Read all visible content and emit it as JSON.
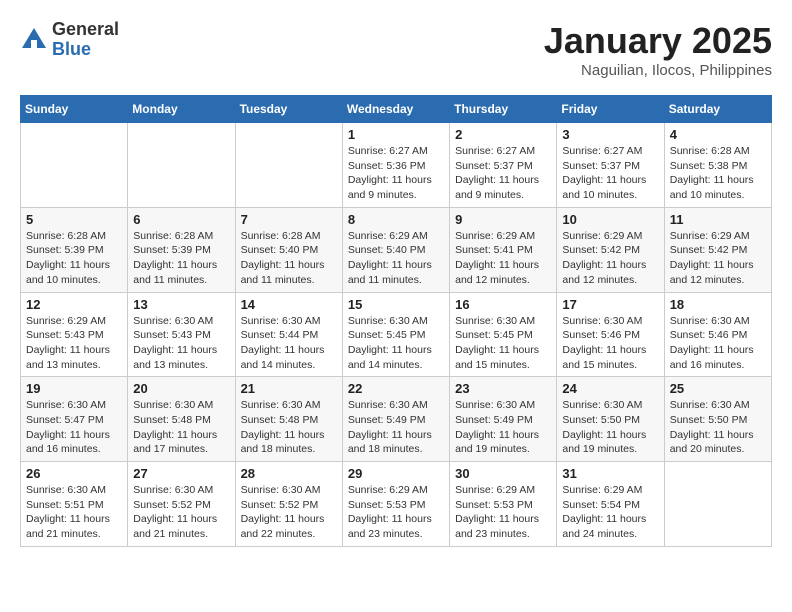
{
  "header": {
    "logo_general": "General",
    "logo_blue": "Blue",
    "month_title": "January 2025",
    "location": "Naguilian, Ilocos, Philippines"
  },
  "days_of_week": [
    "Sunday",
    "Monday",
    "Tuesday",
    "Wednesday",
    "Thursday",
    "Friday",
    "Saturday"
  ],
  "weeks": [
    [
      {
        "day": "",
        "info": ""
      },
      {
        "day": "",
        "info": ""
      },
      {
        "day": "",
        "info": ""
      },
      {
        "day": "1",
        "info": "Sunrise: 6:27 AM\nSunset: 5:36 PM\nDaylight: 11 hours and 9 minutes."
      },
      {
        "day": "2",
        "info": "Sunrise: 6:27 AM\nSunset: 5:37 PM\nDaylight: 11 hours and 9 minutes."
      },
      {
        "day": "3",
        "info": "Sunrise: 6:27 AM\nSunset: 5:37 PM\nDaylight: 11 hours and 10 minutes."
      },
      {
        "day": "4",
        "info": "Sunrise: 6:28 AM\nSunset: 5:38 PM\nDaylight: 11 hours and 10 minutes."
      }
    ],
    [
      {
        "day": "5",
        "info": "Sunrise: 6:28 AM\nSunset: 5:39 PM\nDaylight: 11 hours and 10 minutes."
      },
      {
        "day": "6",
        "info": "Sunrise: 6:28 AM\nSunset: 5:39 PM\nDaylight: 11 hours and 11 minutes."
      },
      {
        "day": "7",
        "info": "Sunrise: 6:28 AM\nSunset: 5:40 PM\nDaylight: 11 hours and 11 minutes."
      },
      {
        "day": "8",
        "info": "Sunrise: 6:29 AM\nSunset: 5:40 PM\nDaylight: 11 hours and 11 minutes."
      },
      {
        "day": "9",
        "info": "Sunrise: 6:29 AM\nSunset: 5:41 PM\nDaylight: 11 hours and 12 minutes."
      },
      {
        "day": "10",
        "info": "Sunrise: 6:29 AM\nSunset: 5:42 PM\nDaylight: 11 hours and 12 minutes."
      },
      {
        "day": "11",
        "info": "Sunrise: 6:29 AM\nSunset: 5:42 PM\nDaylight: 11 hours and 12 minutes."
      }
    ],
    [
      {
        "day": "12",
        "info": "Sunrise: 6:29 AM\nSunset: 5:43 PM\nDaylight: 11 hours and 13 minutes."
      },
      {
        "day": "13",
        "info": "Sunrise: 6:30 AM\nSunset: 5:43 PM\nDaylight: 11 hours and 13 minutes."
      },
      {
        "day": "14",
        "info": "Sunrise: 6:30 AM\nSunset: 5:44 PM\nDaylight: 11 hours and 14 minutes."
      },
      {
        "day": "15",
        "info": "Sunrise: 6:30 AM\nSunset: 5:45 PM\nDaylight: 11 hours and 14 minutes."
      },
      {
        "day": "16",
        "info": "Sunrise: 6:30 AM\nSunset: 5:45 PM\nDaylight: 11 hours and 15 minutes."
      },
      {
        "day": "17",
        "info": "Sunrise: 6:30 AM\nSunset: 5:46 PM\nDaylight: 11 hours and 15 minutes."
      },
      {
        "day": "18",
        "info": "Sunrise: 6:30 AM\nSunset: 5:46 PM\nDaylight: 11 hours and 16 minutes."
      }
    ],
    [
      {
        "day": "19",
        "info": "Sunrise: 6:30 AM\nSunset: 5:47 PM\nDaylight: 11 hours and 16 minutes."
      },
      {
        "day": "20",
        "info": "Sunrise: 6:30 AM\nSunset: 5:48 PM\nDaylight: 11 hours and 17 minutes."
      },
      {
        "day": "21",
        "info": "Sunrise: 6:30 AM\nSunset: 5:48 PM\nDaylight: 11 hours and 18 minutes."
      },
      {
        "day": "22",
        "info": "Sunrise: 6:30 AM\nSunset: 5:49 PM\nDaylight: 11 hours and 18 minutes."
      },
      {
        "day": "23",
        "info": "Sunrise: 6:30 AM\nSunset: 5:49 PM\nDaylight: 11 hours and 19 minutes."
      },
      {
        "day": "24",
        "info": "Sunrise: 6:30 AM\nSunset: 5:50 PM\nDaylight: 11 hours and 19 minutes."
      },
      {
        "day": "25",
        "info": "Sunrise: 6:30 AM\nSunset: 5:50 PM\nDaylight: 11 hours and 20 minutes."
      }
    ],
    [
      {
        "day": "26",
        "info": "Sunrise: 6:30 AM\nSunset: 5:51 PM\nDaylight: 11 hours and 21 minutes."
      },
      {
        "day": "27",
        "info": "Sunrise: 6:30 AM\nSunset: 5:52 PM\nDaylight: 11 hours and 21 minutes."
      },
      {
        "day": "28",
        "info": "Sunrise: 6:30 AM\nSunset: 5:52 PM\nDaylight: 11 hours and 22 minutes."
      },
      {
        "day": "29",
        "info": "Sunrise: 6:29 AM\nSunset: 5:53 PM\nDaylight: 11 hours and 23 minutes."
      },
      {
        "day": "30",
        "info": "Sunrise: 6:29 AM\nSunset: 5:53 PM\nDaylight: 11 hours and 23 minutes."
      },
      {
        "day": "31",
        "info": "Sunrise: 6:29 AM\nSunset: 5:54 PM\nDaylight: 11 hours and 24 minutes."
      },
      {
        "day": "",
        "info": ""
      }
    ]
  ]
}
